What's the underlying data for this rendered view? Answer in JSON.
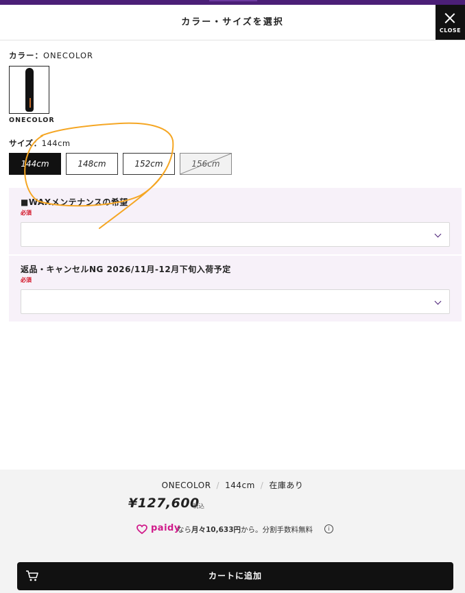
{
  "header": {
    "title": "カラー・サイズを選択",
    "close_label": "CLOSE"
  },
  "color": {
    "label": "カラー：",
    "selected": "ONECOLOR",
    "swatches": [
      {
        "label": "ONECOLOR"
      }
    ]
  },
  "size": {
    "label": "サイズ：",
    "selected": "144cm",
    "options": [
      {
        "label": "144cm",
        "state": "selected"
      },
      {
        "label": "148cm",
        "state": "available"
      },
      {
        "label": "152cm",
        "state": "available"
      },
      {
        "label": "156cm",
        "state": "sold-out"
      }
    ]
  },
  "options": [
    {
      "title": "■WAXメンテナンスの希望",
      "required": "必須",
      "value": ""
    },
    {
      "title": "返品・キャンセルNG 2026/11月-12月下旬入荷予定",
      "required": "必須",
      "value": ""
    }
  ],
  "footer": {
    "summary_color": "ONECOLOR",
    "summary_size": "144cm",
    "summary_stock": "在庫あり",
    "price": "¥127,600",
    "tax_label": "税込",
    "paidy_logo": "paidy",
    "paidy_prefix": "なら",
    "paidy_monthly": "月々10,633円",
    "paidy_suffix": "から。分割手数料無料",
    "info_glyph": "i",
    "cart_label": "カートに追加"
  },
  "colors": {
    "brand_purple": "#4b1f77",
    "required_red": "#d10a1e",
    "paidy_pink": "#d01a8a",
    "annotation_orange": "#f5a623"
  },
  "icons": [
    "close-icon",
    "chevron-down-icon",
    "paidy-icon",
    "info-icon",
    "cart-icon"
  ]
}
